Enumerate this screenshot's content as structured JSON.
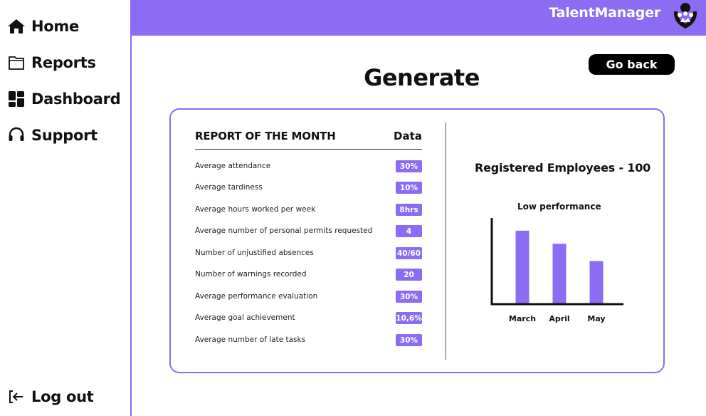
{
  "sidebar": {
    "items": [
      {
        "label": "Home",
        "icon": "home-icon"
      },
      {
        "label": "Reports",
        "icon": "folder-icon"
      },
      {
        "label": "Dashboard",
        "icon": "dashboard-icon"
      },
      {
        "label": "Support",
        "icon": "headset-icon"
      }
    ],
    "logout_label": "Log out"
  },
  "header": {
    "brand": "TalentManager",
    "accent_color": "#8b6cf2"
  },
  "main": {
    "go_back_label": "Go back",
    "title": "Generate"
  },
  "report": {
    "title": "REPORT OF THE MONTH",
    "data_header": "Data",
    "rows": [
      {
        "label": "Average attendance",
        "value": "30%"
      },
      {
        "label": "Average tardiness",
        "value": "10%"
      },
      {
        "label": "Average hours worked per week",
        "value": "8hrs"
      },
      {
        "label": "Average number of personal permits requested",
        "value": "4"
      },
      {
        "label": "Number of unjustified absences",
        "value": "40/60"
      },
      {
        "label": "Number of warnings recorded",
        "value": "20"
      },
      {
        "label": "Average performance evaluation",
        "value": "30%"
      },
      {
        "label": "Average goal achievement",
        "value": "10,6%"
      },
      {
        "label": "Average number of late tasks",
        "value": "30%"
      }
    ]
  },
  "employees": {
    "registered_title": "Registered Employees - 100"
  },
  "chart_data": {
    "type": "bar",
    "title": "Low performance",
    "categories": [
      "March",
      "April",
      "May"
    ],
    "values": [
      100,
      82,
      58
    ],
    "ylim": [
      0,
      120
    ],
    "grid": false,
    "color": "#8b6cf2"
  }
}
